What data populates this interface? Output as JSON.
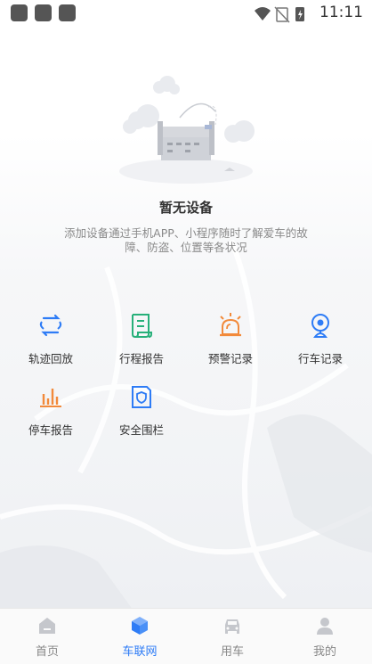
{
  "status_bar": {
    "time": "11:11"
  },
  "empty_state": {
    "title": "暂无设备",
    "description": "添加设备通过手机APP、小程序随时了解爱车的故障、防盗、位置等各状况"
  },
  "features": [
    {
      "label": "轨迹回放",
      "icon": "track-playback-icon",
      "color": "#2e7cf6"
    },
    {
      "label": "行程报告",
      "icon": "trip-report-icon",
      "color": "#27b07a"
    },
    {
      "label": "预警记录",
      "icon": "alarm-light-icon",
      "color": "#f28a3b"
    },
    {
      "label": "行车记录",
      "icon": "dashcam-icon",
      "color": "#2e7cf6"
    },
    {
      "label": "停车报告",
      "icon": "parking-chart-icon",
      "color": "#f28a3b"
    },
    {
      "label": "安全围栏",
      "icon": "security-fence-icon",
      "color": "#2e7cf6"
    }
  ],
  "tabs": [
    {
      "label": "首页",
      "icon": "home-icon",
      "active": false
    },
    {
      "label": "车联网",
      "icon": "iot-cube-icon",
      "active": true
    },
    {
      "label": "用车",
      "icon": "car-icon",
      "active": false
    },
    {
      "label": "我的",
      "icon": "profile-icon",
      "active": false
    }
  ],
  "colors": {
    "accent": "#2e7cf6",
    "inactive_tab": "#888888",
    "warning": "#f28a3b",
    "green": "#27b07a"
  }
}
